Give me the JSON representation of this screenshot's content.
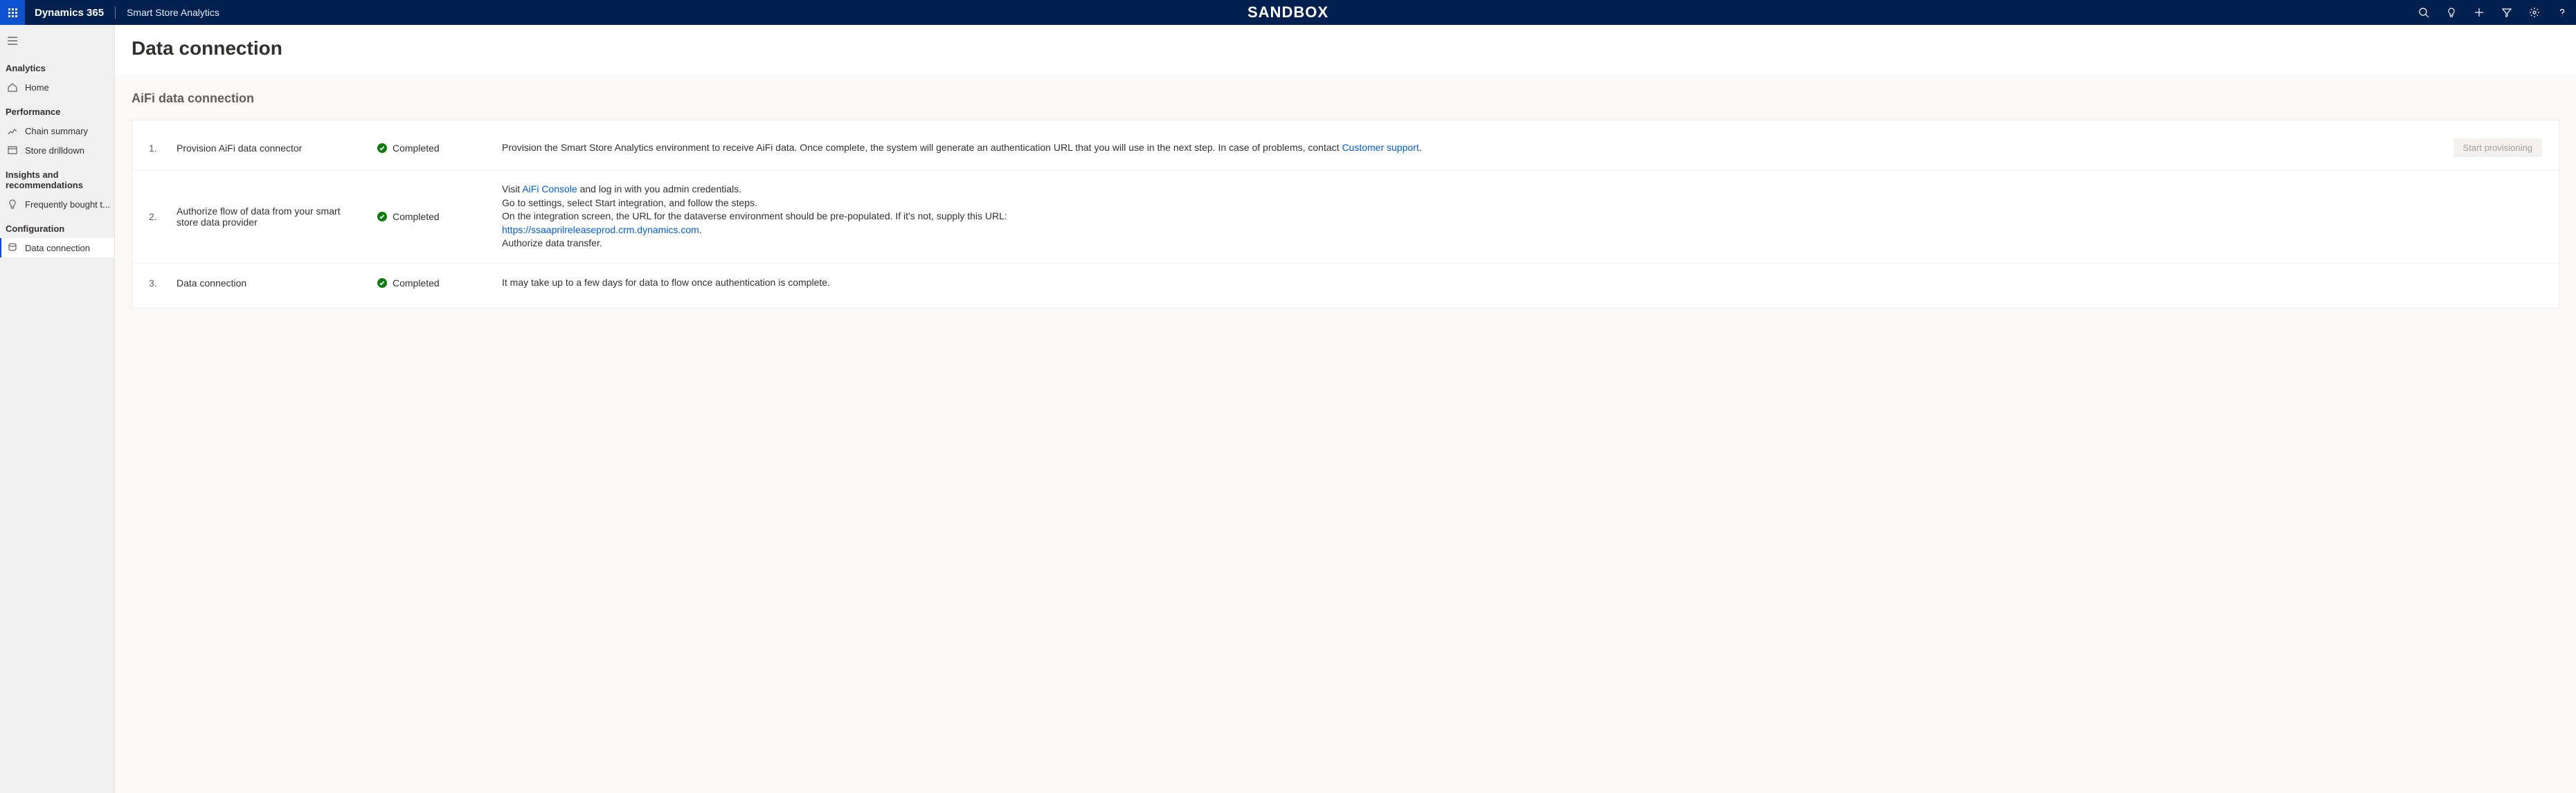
{
  "topbar": {
    "brand": "Dynamics 365",
    "app_name": "Smart Store Analytics",
    "env_label": "SANDBOX"
  },
  "sidebar": {
    "group_analytics": "Analytics",
    "home": "Home",
    "group_performance": "Performance",
    "chain_summary": "Chain summary",
    "store_drilldown": "Store drilldown",
    "group_insights": "Insights and recommendations",
    "frequently_bought": "Frequently bought t...",
    "group_config": "Configuration",
    "data_connection": "Data connection"
  },
  "page": {
    "title": "Data connection",
    "section": "AiFi data connection"
  },
  "steps": {
    "s1": {
      "num": "1.",
      "title": "Provision AiFi data connector",
      "status": "Completed",
      "desc_a": "Provision the Smart Store Analytics environment to receive AiFi data. Once complete, the system will generate an authentication URL that you will use in the next step. In case of problems, contact ",
      "link": "Customer support",
      "desc_b": ".",
      "action": "Start provisioning"
    },
    "s2": {
      "num": "2.",
      "title": "Authorize flow of data from your smart store data provider",
      "status": "Completed",
      "line1_a": "Visit ",
      "line1_link": "AiFi Console",
      "line1_b": " and log in with you admin credentials.",
      "line2": "Go to settings, select Start integration, and follow the steps.",
      "line3": "On the integration screen, the URL for the dataverse environment should be pre-populated. If it's not, supply this URL:",
      "line4_link": "https://ssaaprilreleaseprod.crm.dynamics.com",
      "line4_b": ".",
      "line5": "Authorize data transfer."
    },
    "s3": {
      "num": "3.",
      "title": "Data connection",
      "status": "Completed",
      "desc": "It may take up to a few days for data to flow once authentication is complete."
    }
  }
}
